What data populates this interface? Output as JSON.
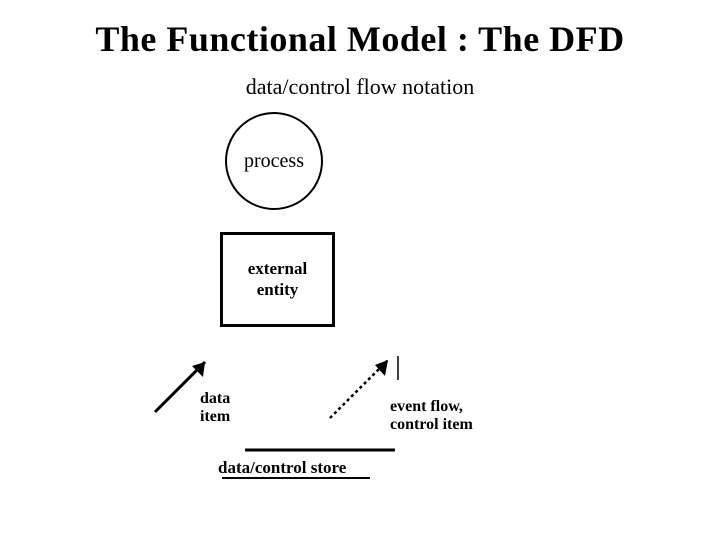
{
  "title": "The Functional Model : The DFD",
  "subtitle": "data/control flow notation",
  "symbols": {
    "process": "process",
    "external_entity": "external\nentity",
    "data_item": "data\nitem",
    "event_flow": "event flow,\ncontrol item",
    "store": "data/control store"
  }
}
